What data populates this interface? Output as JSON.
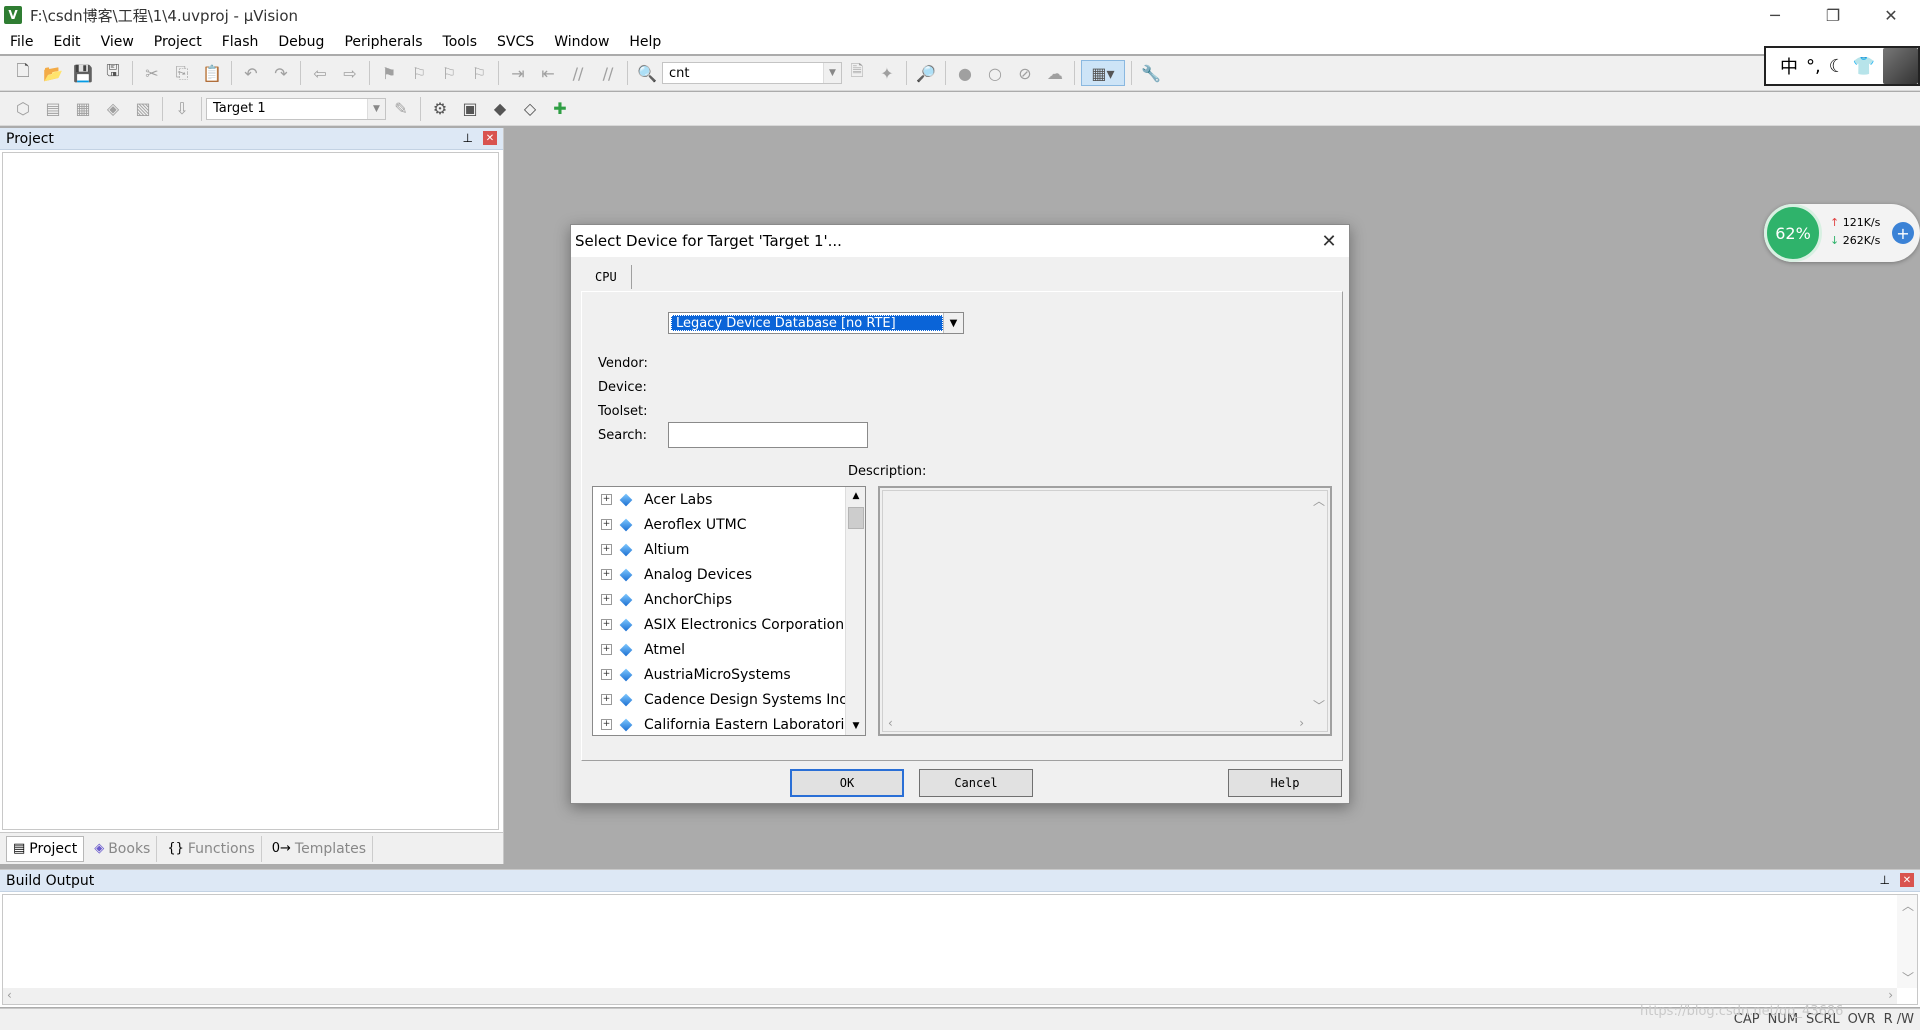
{
  "window": {
    "title": "F:\\csdn博客\\工程\\1\\4.uvproj - µVision",
    "icon_letter": "V",
    "minimize": "─",
    "restore": "❐",
    "close": "✕"
  },
  "menu": [
    "File",
    "Edit",
    "View",
    "Project",
    "Flash",
    "Debug",
    "Peripherals",
    "Tools",
    "SVCS",
    "Window",
    "Help"
  ],
  "toolbar": {
    "find_combo_value": "cnt",
    "target_combo_value": "Target 1"
  },
  "ime": {
    "lang": "中",
    "icons": [
      "°,",
      "☾",
      "👕"
    ]
  },
  "project_panel": {
    "title": "Project",
    "pin": "⊥",
    "close": "✕",
    "tabs": [
      {
        "label": "Project",
        "icon": "▤"
      },
      {
        "label": "Books",
        "icon": "◈"
      },
      {
        "label": "Functions",
        "icon": "{}"
      },
      {
        "label": "Templates",
        "icon": "0→"
      }
    ]
  },
  "build_panel": {
    "title": "Build Output",
    "pin": "⊥",
    "close": "✕"
  },
  "status": [
    "CAP",
    "NUM",
    "SCRL",
    "OVR",
    "R /W"
  ],
  "watermark": "https://blog.csdn.net/qq_43686",
  "net_widget": {
    "percent": "62%",
    "up": "121K/s",
    "down": "262K/s",
    "plus": "+"
  },
  "dialog": {
    "title": "Select Device for Target 'Target 1'...",
    "close": "✕",
    "tab": "CPU",
    "database_selected": "Legacy Device Database [no RTE]",
    "vendor_label": "Vendor:",
    "device_label": "Device:",
    "toolset_label": "Toolset:",
    "search_label": "Search:",
    "search_value": "",
    "description_label": "Description:",
    "vendors": [
      "Acer Labs",
      "Aeroflex UTMC",
      "Altium",
      "Analog Devices",
      "AnchorChips",
      "ASIX Electronics Corporation",
      "Atmel",
      "AustriaMicroSystems",
      "Cadence Design Systems Inc.",
      "California Eastern Laboratories"
    ],
    "ok_label": "OK",
    "cancel_label": "Cancel",
    "help_label": "Help"
  }
}
